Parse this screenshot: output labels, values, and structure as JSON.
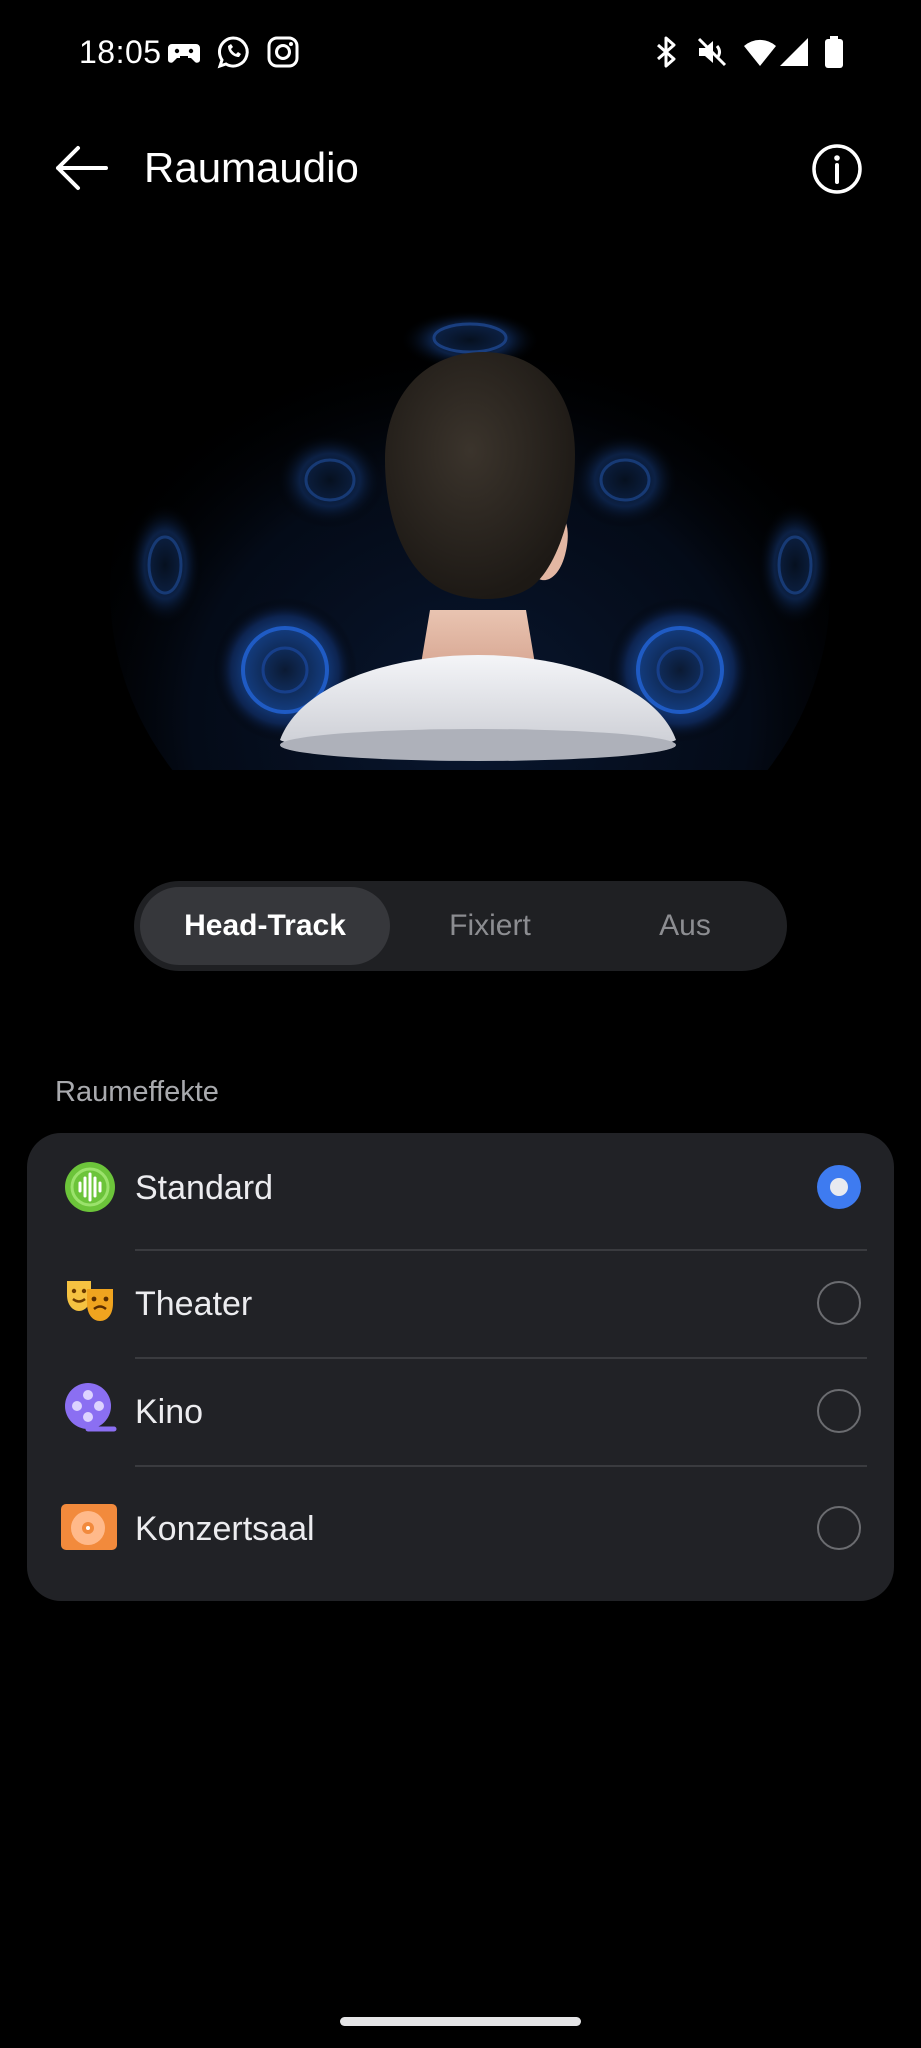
{
  "status_bar": {
    "time": "18:05",
    "left_icons": [
      "game-controller-icon",
      "whatsapp-icon",
      "instagram-icon"
    ],
    "right_icons": [
      "bluetooth-icon",
      "mute-icon",
      "wifi-icon",
      "signal-icon",
      "battery-icon"
    ]
  },
  "header": {
    "title": "Raumaudio",
    "back_icon": "back-arrow-icon",
    "info_icon": "info-icon"
  },
  "illustration": {
    "icon": "head-with-surround-speakers-illustration"
  },
  "mode_selector": {
    "options": [
      "Head-Track",
      "Fixiert",
      "Aus"
    ],
    "selected": "Head-Track"
  },
  "effects": {
    "section_label": "Raumeffekte",
    "items": [
      {
        "label": "Standard",
        "icon": "soundwave-icon",
        "selected": true
      },
      {
        "label": "Theater",
        "icon": "theater-masks-icon",
        "selected": false
      },
      {
        "label": "Kino",
        "icon": "film-reel-icon",
        "selected": false
      },
      {
        "label": "Konzertsaal",
        "icon": "vinyl-record-icon",
        "selected": false
      }
    ]
  },
  "colors": {
    "background": "#000000",
    "card": "#212226",
    "accent": "#3e7bf0",
    "segment_bg": "#1f2023",
    "segment_active": "#36373b"
  }
}
